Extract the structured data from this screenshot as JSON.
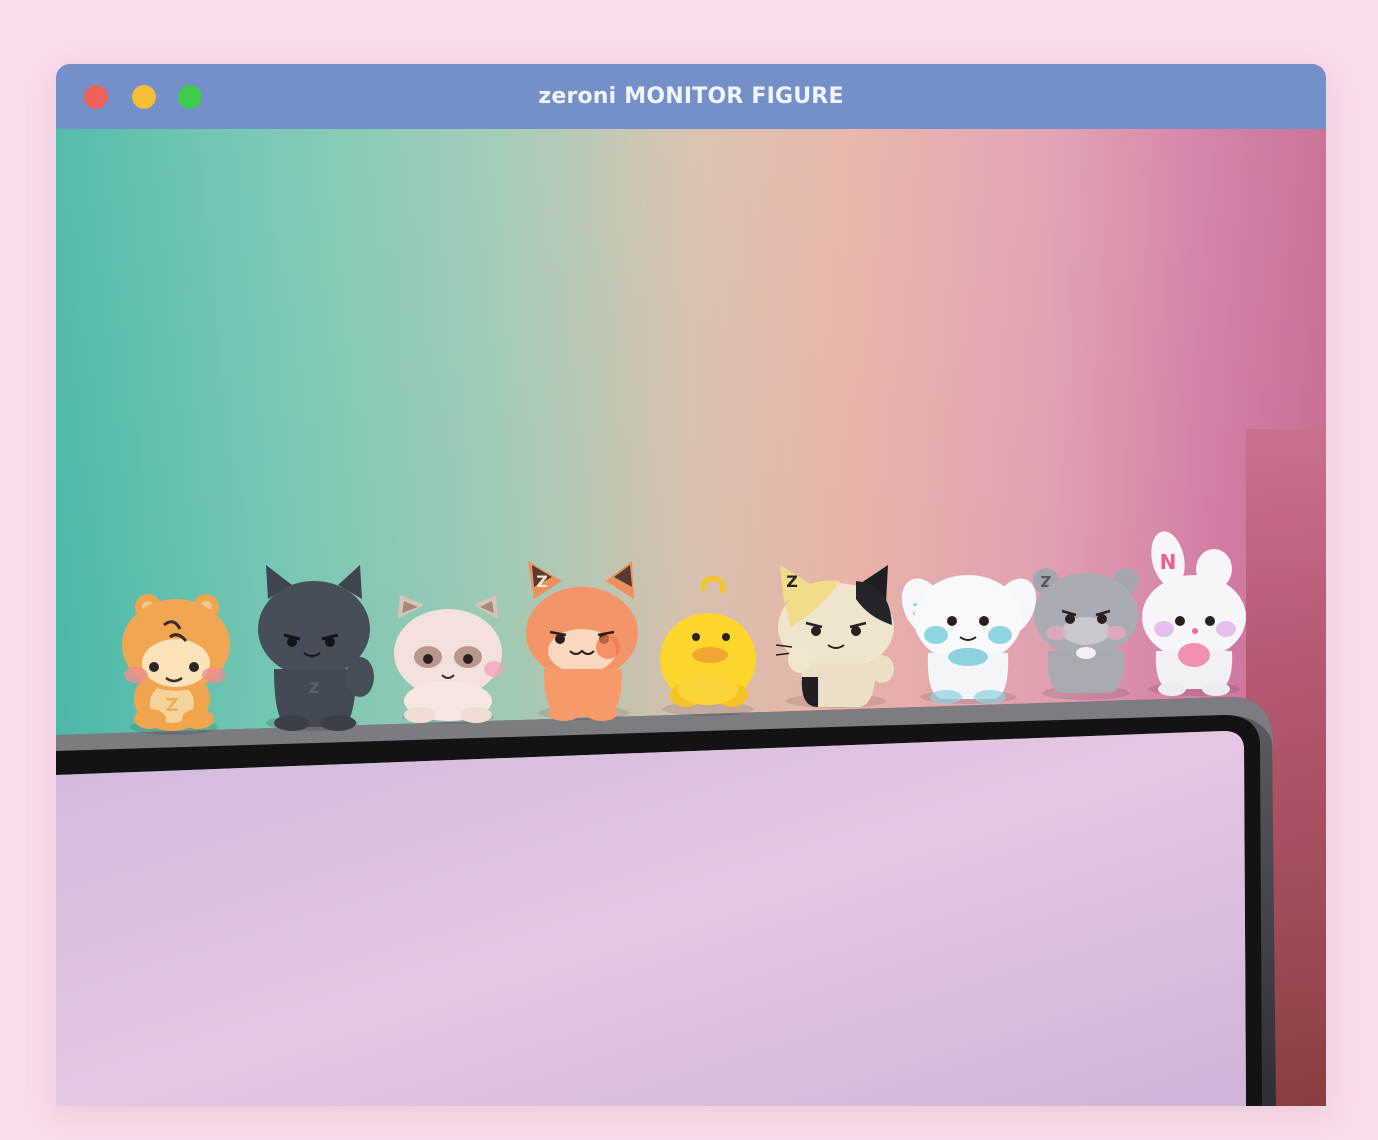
{
  "window": {
    "title": "zeroni MONITOR FIGURE",
    "controls": {
      "close": {
        "icon": "close-traffic-light-icon",
        "color": "#f0615a"
      },
      "minimize": {
        "icon": "minimize-traffic-light-icon",
        "color": "#f6be37"
      },
      "maximize": {
        "icon": "maximize-traffic-light-icon",
        "color": "#3ecb4e"
      }
    }
  },
  "photo": {
    "figures": [
      {
        "icon": "tiger-figure-icon",
        "letter": "Z"
      },
      {
        "icon": "black-cat-figure-icon",
        "letter": "Z"
      },
      {
        "icon": "raccoon-figure-icon",
        "letter": ""
      },
      {
        "icon": "fox-figure-icon",
        "letter": "Z"
      },
      {
        "icon": "duck-figure-icon",
        "letter": ""
      },
      {
        "icon": "calico-cat-figure-icon",
        "letter": "Z"
      },
      {
        "icon": "puppy-figure-icon",
        "letter": "Z"
      },
      {
        "icon": "bear-figure-icon",
        "letter": "Z"
      },
      {
        "icon": "bunny-figure-icon",
        "letter": "N"
      }
    ]
  }
}
